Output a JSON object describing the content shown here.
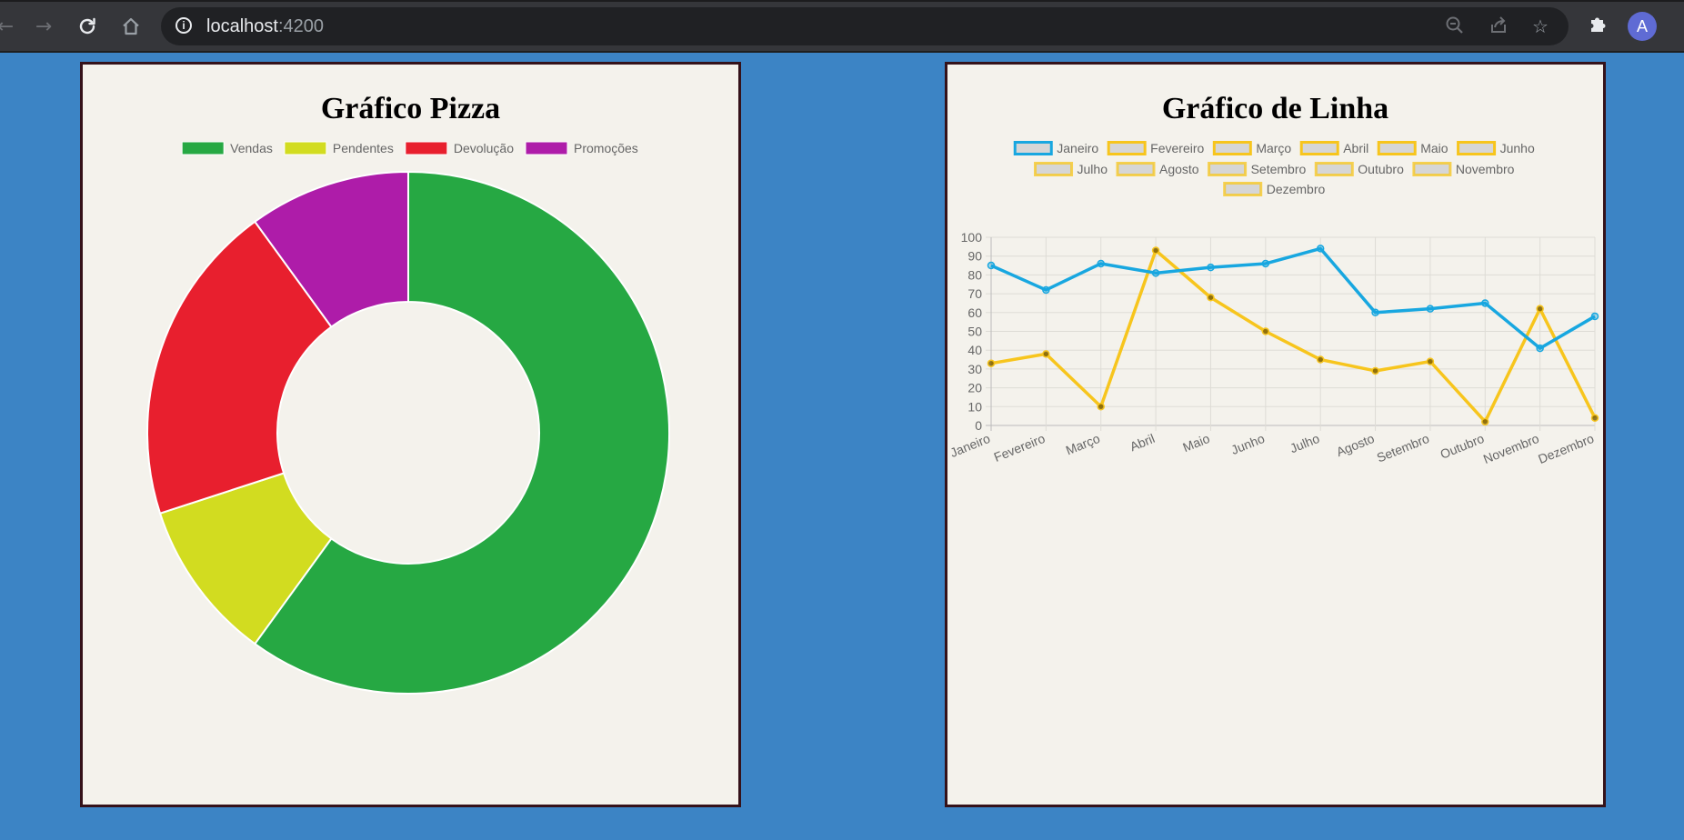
{
  "browser": {
    "url_host": "localhost",
    "url_port": ":4200",
    "avatar_letter": "A",
    "icons": [
      "back-arrow-icon",
      "forward-arrow-icon",
      "reload-icon",
      "home-icon",
      "info-icon",
      "zoom-out-icon",
      "share-icon",
      "bookmark-star-icon",
      "extensions-puzzle-icon"
    ]
  },
  "pie": {
    "title": "Gráfico Pizza",
    "chart_data": {
      "type": "pie",
      "variant": "doughnut",
      "legend_position": "top",
      "labels": [
        "Vendas",
        "Pendentes",
        "Devolução",
        "Promoções"
      ],
      "values": [
        60,
        10,
        20,
        10
      ],
      "colors": [
        "#26a843",
        "#d2dc20",
        "#e81f2e",
        "#ae1ca9"
      ]
    }
  },
  "line": {
    "title": "Gráfico de Linha",
    "chart_data": {
      "type": "line",
      "legend_position": "top",
      "legend_labels": [
        "Janeiro",
        "Fevereiro",
        "Março",
        "Abril",
        "Maio",
        "Junho",
        "Julho",
        "Agosto",
        "Setembro",
        "Outubro",
        "Novembro",
        "Dezembro"
      ],
      "legend_colors": [
        "#18a7e0",
        "#f7c51d",
        "#f7c51d",
        "#f7c51d",
        "#f7c51d",
        "#f7c51d",
        "#f7c51d",
        "#f7c51d",
        "#f7c51d",
        "#f7c51d",
        "#f7c51d",
        "#f7c51d"
      ],
      "categories": [
        "Janeiro",
        "Fevereiro",
        "Março",
        "Abril",
        "Maio",
        "Junho",
        "Julho",
        "Agosto",
        "Setembro",
        "Outubro",
        "Novembro",
        "Dezembro"
      ],
      "ylim": [
        0,
        100
      ],
      "yticks": [
        0,
        10,
        20,
        30,
        40,
        50,
        60,
        70,
        80,
        90,
        100
      ],
      "grid": true,
      "series": [
        {
          "values": [
            85,
            72,
            86,
            81,
            84,
            86,
            94,
            60,
            62,
            65,
            41,
            58
          ],
          "color": "#18a7e0"
        },
        {
          "values": [
            33,
            38,
            10,
            93,
            68,
            50,
            35,
            29,
            34,
            2,
            62,
            4
          ],
          "color": "#f7c51d"
        }
      ]
    }
  }
}
